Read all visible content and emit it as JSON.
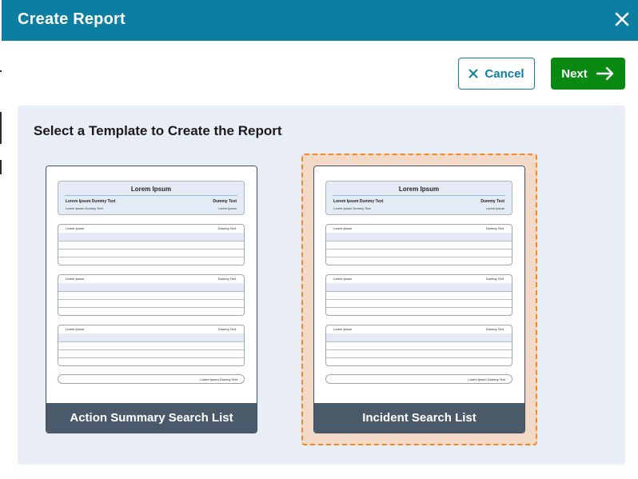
{
  "dialog": {
    "title": "Create Report",
    "close_icon": "close-icon"
  },
  "actions": {
    "cancel_label": "Cancel",
    "cancel_icon": "x-icon",
    "next_label": "Next",
    "next_icon": "arrow-right-icon"
  },
  "panel": {
    "title": "Select a Template to Create the Report"
  },
  "templates": [
    {
      "label": "Action Summary Search List",
      "selected": false,
      "preview": {
        "header_title": "Lorem Ipsum",
        "header_left": "Lorem Ipsum Dummy Text",
        "header_right": "Dummy Text",
        "header_sub_left": "Lorem Ipsum Dummy Text",
        "header_sub_right": "Lorem Ipsum",
        "table1_left": "Lorem Ipsum",
        "table1_right": "Dummy Text",
        "table2_left": "Lorem Ipsum",
        "table2_right": "Dummy Text",
        "table3_left": "Lorem Ipsum",
        "table3_right": "Dummy Text",
        "footer": "Lorem Ipsum Dummy Text"
      }
    },
    {
      "label": "Incident Search List",
      "selected": true,
      "preview": {
        "header_title": "Lorem Ipsum",
        "header_left": "Lorem Ipsum Dummy Text",
        "header_right": "Dummy Text",
        "header_sub_left": "Lorem Ipsum Dummy Text",
        "header_sub_right": "Lorem Ipsum",
        "table1_left": "Lorem Ipsum",
        "table1_right": "Dummy Text",
        "table2_left": "Lorem Ipsum",
        "table2_right": "Dummy Text",
        "table3_left": "Lorem Ipsum",
        "table3_right": "Dummy Text",
        "footer": "Lorem Ipsum Dummy Text"
      }
    }
  ],
  "colors": {
    "header_bg": "#0b7ea1",
    "next_bg": "#0a8a13",
    "panel_bg": "#e9eef6",
    "card_label_bg": "#4b5a6b",
    "selected_border": "#f08a24",
    "selected_bg": "#f2d9c8"
  }
}
